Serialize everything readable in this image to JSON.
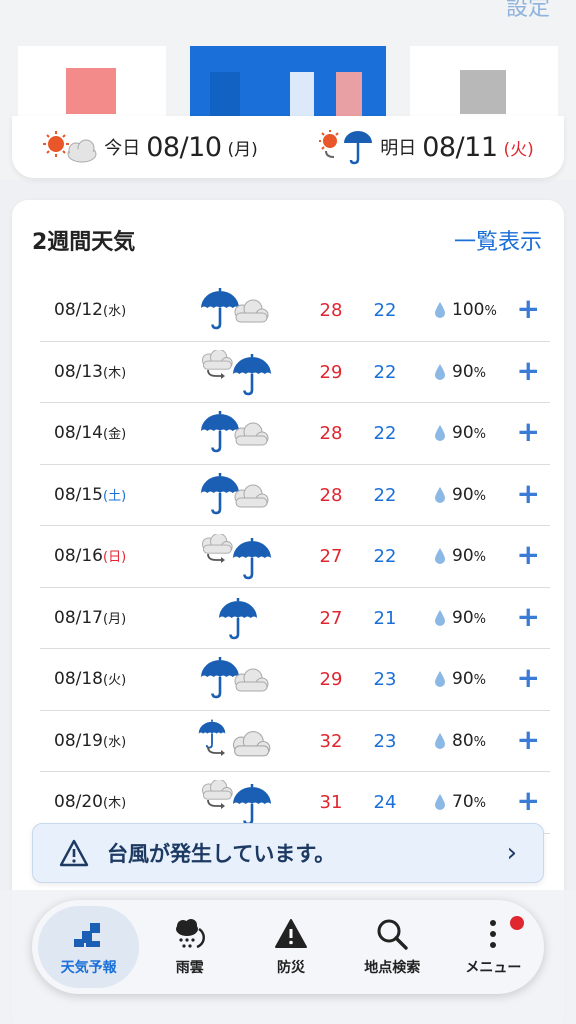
{
  "header": {
    "settings_label": "設定"
  },
  "dates": [
    {
      "prefix": "今日",
      "date": "08/10",
      "dow": "(月)",
      "dow_color": "normal",
      "icon": "sunny-then-cloudy-icon"
    },
    {
      "prefix": "明日",
      "date": "08/11",
      "dow": "(火)",
      "dow_color": "red",
      "icon": "sunny-then-rain-icon"
    }
  ],
  "section": {
    "title": "2週間天気",
    "list_link": "一覧表示"
  },
  "forecast": [
    {
      "date": "08/12",
      "dow": "(水)",
      "dow_color": "normal",
      "icon": "rain-cloud-icon",
      "high": "28",
      "low": "22",
      "pop": "100",
      "unit": "%"
    },
    {
      "date": "08/13",
      "dow": "(木)",
      "dow_color": "normal",
      "icon": "cloud-then-rain-icon",
      "high": "29",
      "low": "22",
      "pop": "90",
      "unit": "%"
    },
    {
      "date": "08/14",
      "dow": "(金)",
      "dow_color": "normal",
      "icon": "rain-cloud-icon",
      "high": "28",
      "low": "22",
      "pop": "90",
      "unit": "%"
    },
    {
      "date": "08/15",
      "dow": "(土)",
      "dow_color": "blue",
      "icon": "rain-cloud-icon",
      "high": "28",
      "low": "22",
      "pop": "90",
      "unit": "%"
    },
    {
      "date": "08/16",
      "dow": "(日)",
      "dow_color": "red",
      "icon": "cloud-then-rain-icon",
      "high": "27",
      "low": "22",
      "pop": "90",
      "unit": "%"
    },
    {
      "date": "08/17",
      "dow": "(月)",
      "dow_color": "normal",
      "icon": "rain-icon",
      "high": "27",
      "low": "21",
      "pop": "90",
      "unit": "%"
    },
    {
      "date": "08/18",
      "dow": "(火)",
      "dow_color": "normal",
      "icon": "rain-cloud-icon",
      "high": "29",
      "low": "23",
      "pop": "90",
      "unit": "%"
    },
    {
      "date": "08/19",
      "dow": "(水)",
      "dow_color": "normal",
      "icon": "rain-then-cloudy-icon",
      "high": "32",
      "low": "23",
      "pop": "80",
      "unit": "%"
    },
    {
      "date": "08/20",
      "dow": "(木)",
      "dow_color": "normal",
      "icon": "cloud-then-rain-icon",
      "high": "31",
      "low": "24",
      "pop": "70",
      "unit": "%"
    }
  ],
  "alert": {
    "text": "台風が発生しています。"
  },
  "nav": [
    {
      "label": "天気予報",
      "icon": "weather-forecast-icon",
      "active": true
    },
    {
      "label": "雨雲",
      "icon": "rain-cloud-radar-icon",
      "active": false
    },
    {
      "label": "防災",
      "icon": "warning-icon",
      "active": false
    },
    {
      "label": "地点検索",
      "icon": "search-icon",
      "active": false
    },
    {
      "label": "メニュー",
      "icon": "menu-icon",
      "active": false,
      "badge": true
    }
  ],
  "colors": {
    "accent": "#1a6fd8",
    "high_temp": "#e0262f",
    "low_temp": "#1a6fd8",
    "alert_bg": "#e8f0fb"
  }
}
